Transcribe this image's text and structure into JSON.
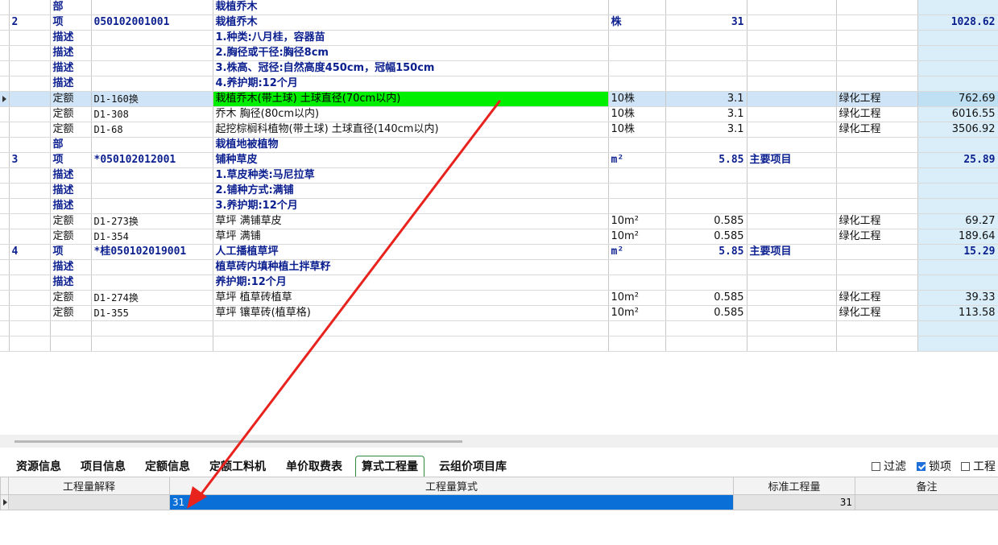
{
  "grid": {
    "rows": [
      {
        "kind": "sec",
        "no": "",
        "type": "部",
        "code": "",
        "name": "栽植乔木",
        "unit": "",
        "qty": "",
        "note": "",
        "cat": "",
        "total": "",
        "selected": false
      },
      {
        "kind": "sec",
        "no": "2",
        "type": "项",
        "code": "050102001001",
        "name": "栽植乔木",
        "unit": "株",
        "qty": "31",
        "note": "",
        "cat": "",
        "total": "1028.62",
        "selected": false
      },
      {
        "kind": "desc",
        "no": "",
        "type": "描述",
        "code": "",
        "name": "1.种类:八月桂，容器苗",
        "unit": "",
        "qty": "",
        "note": "",
        "cat": "",
        "total": "",
        "selected": false
      },
      {
        "kind": "desc",
        "no": "",
        "type": "描述",
        "code": "",
        "name": "2.胸径或干径:胸径8cm",
        "unit": "",
        "qty": "",
        "note": "",
        "cat": "",
        "total": "",
        "selected": false
      },
      {
        "kind": "desc",
        "no": "",
        "type": "描述",
        "code": "",
        "name": "3.株高、冠径:自然高度450cm，冠幅150cm",
        "unit": "",
        "qty": "",
        "note": "",
        "cat": "",
        "total": "",
        "selected": false
      },
      {
        "kind": "desc",
        "no": "",
        "type": "描述",
        "code": "",
        "name": "4.养护期:12个月",
        "unit": "",
        "qty": "",
        "note": "",
        "cat": "",
        "total": "",
        "selected": false
      },
      {
        "kind": "quota",
        "no": "",
        "type": "定额",
        "code": "D1-160换",
        "name": "栽植乔木(带土球) 土球直径(70cm以内)",
        "unit": "10株",
        "qty": "3.1",
        "note": "",
        "cat": "绿化工程",
        "total": "762.69",
        "selected": true
      },
      {
        "kind": "quota",
        "no": "",
        "type": "定额",
        "code": "D1-308",
        "name": "乔木 胸径(80cm以内)",
        "unit": "10株",
        "qty": "3.1",
        "note": "",
        "cat": "绿化工程",
        "total": "6016.55",
        "selected": false
      },
      {
        "kind": "quota",
        "no": "",
        "type": "定额",
        "code": "D1-68",
        "name": "起挖棕榈科植物(带土球) 土球直径(140cm以内)",
        "unit": "10株",
        "qty": "3.1",
        "note": "",
        "cat": "绿化工程",
        "total": "3506.92",
        "selected": false
      },
      {
        "kind": "sec",
        "no": "",
        "type": "部",
        "code": "",
        "name": "栽植地被植物",
        "unit": "",
        "qty": "",
        "note": "",
        "cat": "",
        "total": "",
        "selected": false
      },
      {
        "kind": "sec",
        "no": "3",
        "type": "项",
        "code": "*050102012001",
        "name": "铺种草皮",
        "unit": "m²",
        "qty": "5.85",
        "note": "主要项目",
        "cat": "",
        "total": "25.89",
        "selected": false
      },
      {
        "kind": "desc",
        "no": "",
        "type": "描述",
        "code": "",
        "name": "1.草皮种类:马尼拉草",
        "unit": "",
        "qty": "",
        "note": "",
        "cat": "",
        "total": "",
        "selected": false
      },
      {
        "kind": "desc",
        "no": "",
        "type": "描述",
        "code": "",
        "name": "2.铺种方式:满铺",
        "unit": "",
        "qty": "",
        "note": "",
        "cat": "",
        "total": "",
        "selected": false
      },
      {
        "kind": "desc",
        "no": "",
        "type": "描述",
        "code": "",
        "name": "3.养护期:12个月",
        "unit": "",
        "qty": "",
        "note": "",
        "cat": "",
        "total": "",
        "selected": false
      },
      {
        "kind": "quota",
        "no": "",
        "type": "定额",
        "code": "D1-273换",
        "name": "草坪 满铺草皮",
        "unit": "10m²",
        "qty": "0.585",
        "note": "",
        "cat": "绿化工程",
        "total": "69.27",
        "selected": false
      },
      {
        "kind": "quota",
        "no": "",
        "type": "定额",
        "code": "D1-354",
        "name": "草坪 满铺",
        "unit": "10m²",
        "qty": "0.585",
        "note": "",
        "cat": "绿化工程",
        "total": "189.64",
        "selected": false
      },
      {
        "kind": "sec",
        "no": "4",
        "type": "项",
        "code": "*桂050102019001",
        "name": "人工播植草坪",
        "unit": "m²",
        "qty": "5.85",
        "note": "主要项目",
        "cat": "",
        "total": "15.29",
        "selected": false
      },
      {
        "kind": "desc",
        "no": "",
        "type": "描述",
        "code": "",
        "name": "植草砖内填种植土拌草籽",
        "unit": "",
        "qty": "",
        "note": "",
        "cat": "",
        "total": "",
        "selected": false
      },
      {
        "kind": "desc",
        "no": "",
        "type": "描述",
        "code": "",
        "name": "养护期:12个月",
        "unit": "",
        "qty": "",
        "note": "",
        "cat": "",
        "total": "",
        "selected": false
      },
      {
        "kind": "quota",
        "no": "",
        "type": "定额",
        "code": "D1-274换",
        "name": "草坪 植草砖植草",
        "unit": "10m²",
        "qty": "0.585",
        "note": "",
        "cat": "绿化工程",
        "total": "39.33",
        "selected": false
      },
      {
        "kind": "quota",
        "no": "",
        "type": "定额",
        "code": "D1-355",
        "name": "草坪 镶草砖(植草格)",
        "unit": "10m²",
        "qty": "0.585",
        "note": "",
        "cat": "绿化工程",
        "total": "113.58",
        "selected": false
      },
      {
        "kind": "empty",
        "no": "",
        "type": "",
        "code": "",
        "name": "",
        "unit": "",
        "qty": "",
        "note": "",
        "cat": "",
        "total": "",
        "selected": false
      },
      {
        "kind": "empty",
        "no": "",
        "type": "",
        "code": "",
        "name": "",
        "unit": "",
        "qty": "",
        "note": "",
        "cat": "",
        "total": "",
        "selected": false
      }
    ]
  },
  "tabs": [
    {
      "label": "资源信息",
      "active": false
    },
    {
      "label": "项目信息",
      "active": false
    },
    {
      "label": "定额信息",
      "active": false
    },
    {
      "label": "定额工料机",
      "active": false
    },
    {
      "label": "单价取费表",
      "active": false
    },
    {
      "label": "算式工程量",
      "active": true
    },
    {
      "label": "云组价项目库",
      "active": false
    }
  ],
  "options": {
    "filter_label": "过滤",
    "filter_checked": false,
    "lock_label": "锁项",
    "lock_checked": true,
    "engineering_label": "工程",
    "engineering_checked": false
  },
  "subtable": {
    "headers": {
      "explain": "工程量解释",
      "formula": "工程量算式",
      "standard": "标准工程量",
      "remark": "备注"
    },
    "row": {
      "explain": "",
      "formula": "31",
      "standard": "31",
      "remark": ""
    }
  },
  "colors": {
    "accent_arrow": "#e8231e",
    "selected_name_bg": "#00ee00",
    "formula_bg": "#0a6fd6"
  }
}
